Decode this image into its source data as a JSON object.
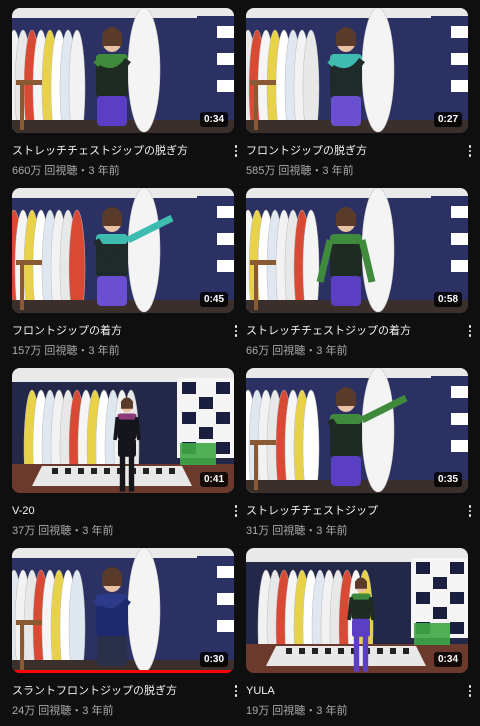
{
  "videos": [
    {
      "title": "ストレッチチェストジップの脱ぎ方",
      "views": "660万 回視聴",
      "age": "3 年前",
      "duration": "0:34",
      "scene": "shop",
      "pose": "wrap",
      "suit": "black-green",
      "progress": 0
    },
    {
      "title": "フロントジップの脱ぎ方",
      "views": "585万 回視聴",
      "age": "3 年前",
      "duration": "0:27",
      "scene": "shop",
      "pose": "wrap",
      "suit": "teal",
      "progress": 0
    },
    {
      "title": "フロントジップの着方",
      "views": "157万 回視聴",
      "age": "3 年前",
      "duration": "0:45",
      "scene": "shop",
      "pose": "point",
      "suit": "teal",
      "progress": 0
    },
    {
      "title": "ストレッチチェストジップの着方",
      "views": "66万 回視聴",
      "age": "3 年前",
      "duration": "0:58",
      "scene": "shop",
      "pose": "down",
      "suit": "black-green",
      "progress": 0
    },
    {
      "title": "V-20",
      "views": "37万 回視聴",
      "age": "3 年前",
      "duration": "0:41",
      "scene": "wide",
      "pose": "stand",
      "suit": "black",
      "progress": 0
    },
    {
      "title": "ストレッチチェストジップ",
      "views": "31万 回視聴",
      "age": "3 年前",
      "duration": "0:35",
      "scene": "shop",
      "pose": "point",
      "suit": "black-green",
      "progress": 0
    },
    {
      "title": "スラントフロントジップの脱ぎ方",
      "views": "24万 回視聴",
      "age": "3 年前",
      "duration": "0:30",
      "scene": "shop",
      "pose": "wrap",
      "suit": "navy",
      "progress": 1.0
    },
    {
      "title": "YULA",
      "views": "19万 回視聴",
      "age": "3 年前",
      "duration": "0:34",
      "scene": "wide",
      "pose": "stand",
      "suit": "black-green",
      "progress": 0
    }
  ],
  "separator": "・",
  "colors": {
    "progress": "#ff0000",
    "wall": "#2b3163",
    "meta": "#aaaaaa"
  }
}
